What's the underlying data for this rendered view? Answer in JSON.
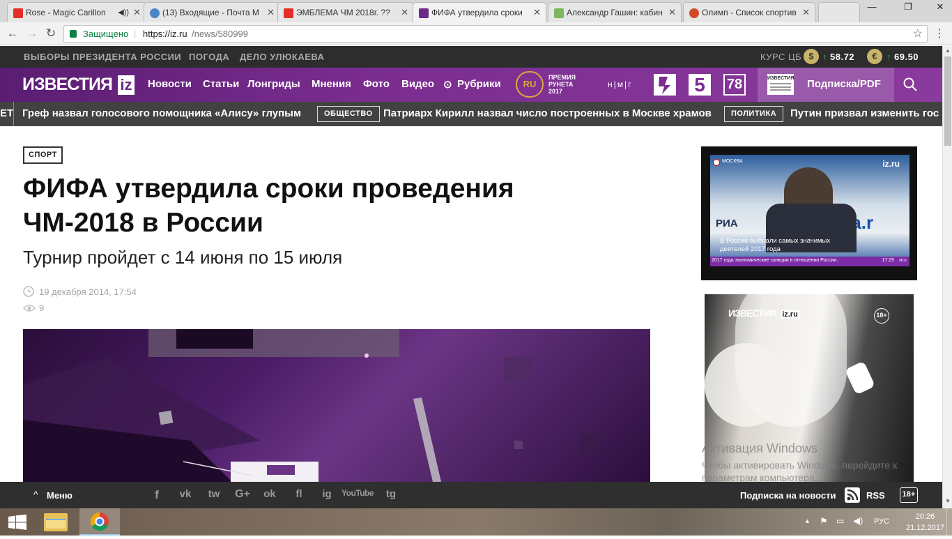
{
  "browser": {
    "tabs": [
      {
        "title": "Rose - Magic Carillon",
        "active": false,
        "icon_color": "#e52d27"
      },
      {
        "title": "(13) Входящие - Почта М",
        "active": false,
        "icon_color": "#4d86c6"
      },
      {
        "title": "ЭМБЛЕМА ЧМ 2018г. ??",
        "active": false,
        "icon_color": "#e52d27"
      },
      {
        "title": "ФИФА утвердила сроки",
        "active": true,
        "icon_color": "#6b2a85"
      },
      {
        "title": "Александр Гашин: кабин",
        "active": false,
        "icon_color": "#7bb661"
      },
      {
        "title": "Олимп - Список спортив",
        "active": false,
        "icon_color": "#d04a2a"
      }
    ],
    "secure_label": "Защищено",
    "url_host": "https://iz.ru",
    "url_path": "/news/580999"
  },
  "site": {
    "top_links": [
      "ВЫБОРЫ ПРЕЗИДЕНТА РОССИИ",
      "ПОГОДА",
      "ДЕЛО УЛЮКАЕВА"
    ],
    "rates_label": "КУРС ЦБ",
    "usd_symbol": "$",
    "usd_value": "58.72",
    "eur_symbol": "€",
    "eur_value": "69.50",
    "logo_text": "ИЗВЕСТИЯ",
    "logo_badge": "iz",
    "nav": [
      "Новости",
      "Статьи",
      "Лонгриды",
      "Мнения",
      "Фото",
      "Видео",
      "Рубрики"
    ],
    "award_badge": "RU",
    "award_lines": [
      "ПРЕМИЯ",
      "РУНЕТА",
      "2017"
    ],
    "nmg": "н|м|г",
    "channel_5": "5",
    "channel_78": "78",
    "subscribe_pdf": "Подписка/PDF",
    "subscribe_pdf_logo": "ИЗВЕСТИЯ"
  },
  "ticker": [
    {
      "tag": "",
      "prefix": "ЕТ",
      "text": "Греф назвал голосового помощника «Алису» глупым"
    },
    {
      "tag": "ОБЩЕСТВО",
      "text": "Патриарх Кирилл назвал число построенных в Москве храмов"
    },
    {
      "tag": "ПОЛИТИКА",
      "text": "Путин призвал изменить гос"
    }
  ],
  "article": {
    "category": "СПОРТ",
    "headline_line1": "ФИФА утвердила сроки проведения",
    "headline_line2": "ЧМ-2018 в России",
    "subheadline": "Турнир пройдет с 14 июня по 15 июля",
    "date": "19 декабря 2014, 17:54",
    "views": "9"
  },
  "video": {
    "city": "МОСКВА",
    "brand": "iz.ru",
    "backdrop_text": "РИА",
    "backdrop_text2": "ria.r",
    "caption_line1": "В России выбрали самых значимых",
    "caption_line2": "деятелей 2017 года",
    "crawl": "2017 года экономические санкции в отношении России.",
    "time": "17:25",
    "time_city": "МСК"
  },
  "ad": {
    "logo": "ИЗВЕСТИЯ",
    "logo_badge": "iz.ru",
    "age": "18+"
  },
  "windows_activation": {
    "title": "Активация Windows",
    "line1": "Чтобы активировать Windows, перейдите к",
    "line2": "параметрам компьютера."
  },
  "bottom_bar": {
    "menu": "Меню",
    "social": [
      "f",
      "vk",
      "tw",
      "G+",
      "ok",
      "fl",
      "ig",
      "YouTube",
      "tg"
    ],
    "newsletter": "Подписка на новости",
    "rss": "RSS",
    "age": "18+"
  },
  "taskbar": {
    "lang": "РУС",
    "time": "20:26",
    "date": "21.12.2017"
  }
}
